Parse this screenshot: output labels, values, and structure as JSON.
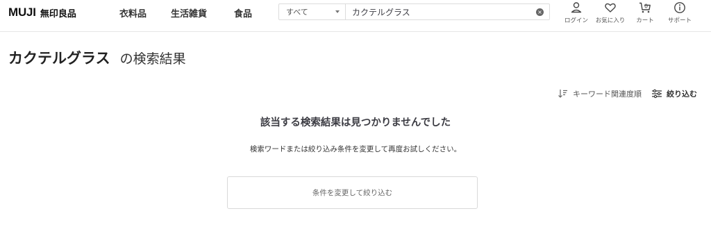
{
  "header": {
    "logo_latin": "MUJI",
    "logo_jp": "無印良品",
    "nav": [
      "衣料品",
      "生活雑貨",
      "食品"
    ],
    "search": {
      "scope_label": "すべて",
      "query": "カクテルグラス"
    },
    "utils": [
      {
        "label": "ログイン",
        "icon": "person-icon"
      },
      {
        "label": "お気に入り",
        "icon": "heart-icon"
      },
      {
        "label": "カート",
        "icon": "cart-icon",
        "count": "0"
      },
      {
        "label": "サポート",
        "icon": "info-icon"
      }
    ]
  },
  "results": {
    "query": "カクテルグラス",
    "title_suffix": "の検索結果",
    "sort_label": "キーワード関連度順",
    "filter_label": "絞り込む",
    "no_result_heading": "該当する検索結果は見つかりませんでした",
    "no_result_hint": "検索ワードまたは絞り込み条件を変更して再度お試しください。",
    "change_button": "条件を変更して絞り込む"
  },
  "colors": {
    "text": "#3c3c43",
    "border": "#d9d9d9"
  }
}
